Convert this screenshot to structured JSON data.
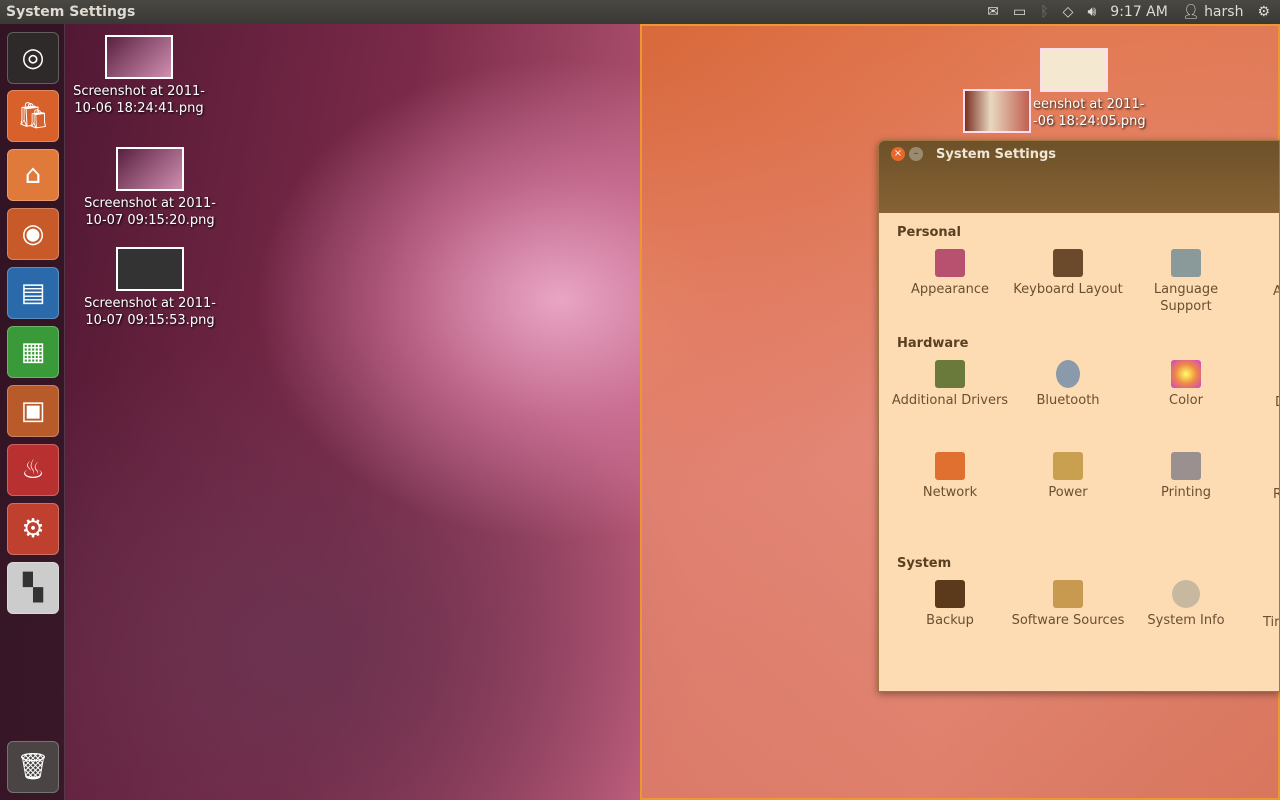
{
  "topbar": {
    "title": "System Settings",
    "time": "9:17 AM",
    "user": "harsh",
    "indicators": [
      "mail-icon",
      "battery-icon",
      "bluetooth-icon",
      "wifi-icon",
      "volume-icon"
    ]
  },
  "launcher": [
    "ubuntu-dash",
    "software-center",
    "home-folder",
    "firefox",
    "libreoffice-writer",
    "libreoffice-calc",
    "libreoffice-impress",
    "burner",
    "system-settings",
    "workspace-switcher",
    "trash"
  ],
  "desktop": [
    {
      "line1": "Screenshot at 2011-",
      "line2": "10-06 18:24:41.png"
    },
    {
      "line1": "Screenshot at 2011-",
      "line2": "10-07 09:15:20.png"
    },
    {
      "line1": "Screenshot at 2011-",
      "line2": "10-07 09:15:53.png"
    },
    {
      "line1": "eenshot at 2011-",
      "line2": "-06 18:24:05.png"
    }
  ],
  "window": {
    "title": "System Settings",
    "sections": [
      {
        "name": "Personal",
        "items": [
          "Appearance",
          "Keyboard Layout",
          "Language Support",
          "A"
        ]
      },
      {
        "name": "Hardware",
        "items": [
          "Additional Drivers",
          "Bluetooth",
          "Color",
          "D",
          "Network",
          "Power",
          "Printing",
          "Re"
        ]
      },
      {
        "name": "System",
        "items": [
          "Backup",
          "Software Sources",
          "System Info",
          "Tir"
        ]
      }
    ]
  }
}
